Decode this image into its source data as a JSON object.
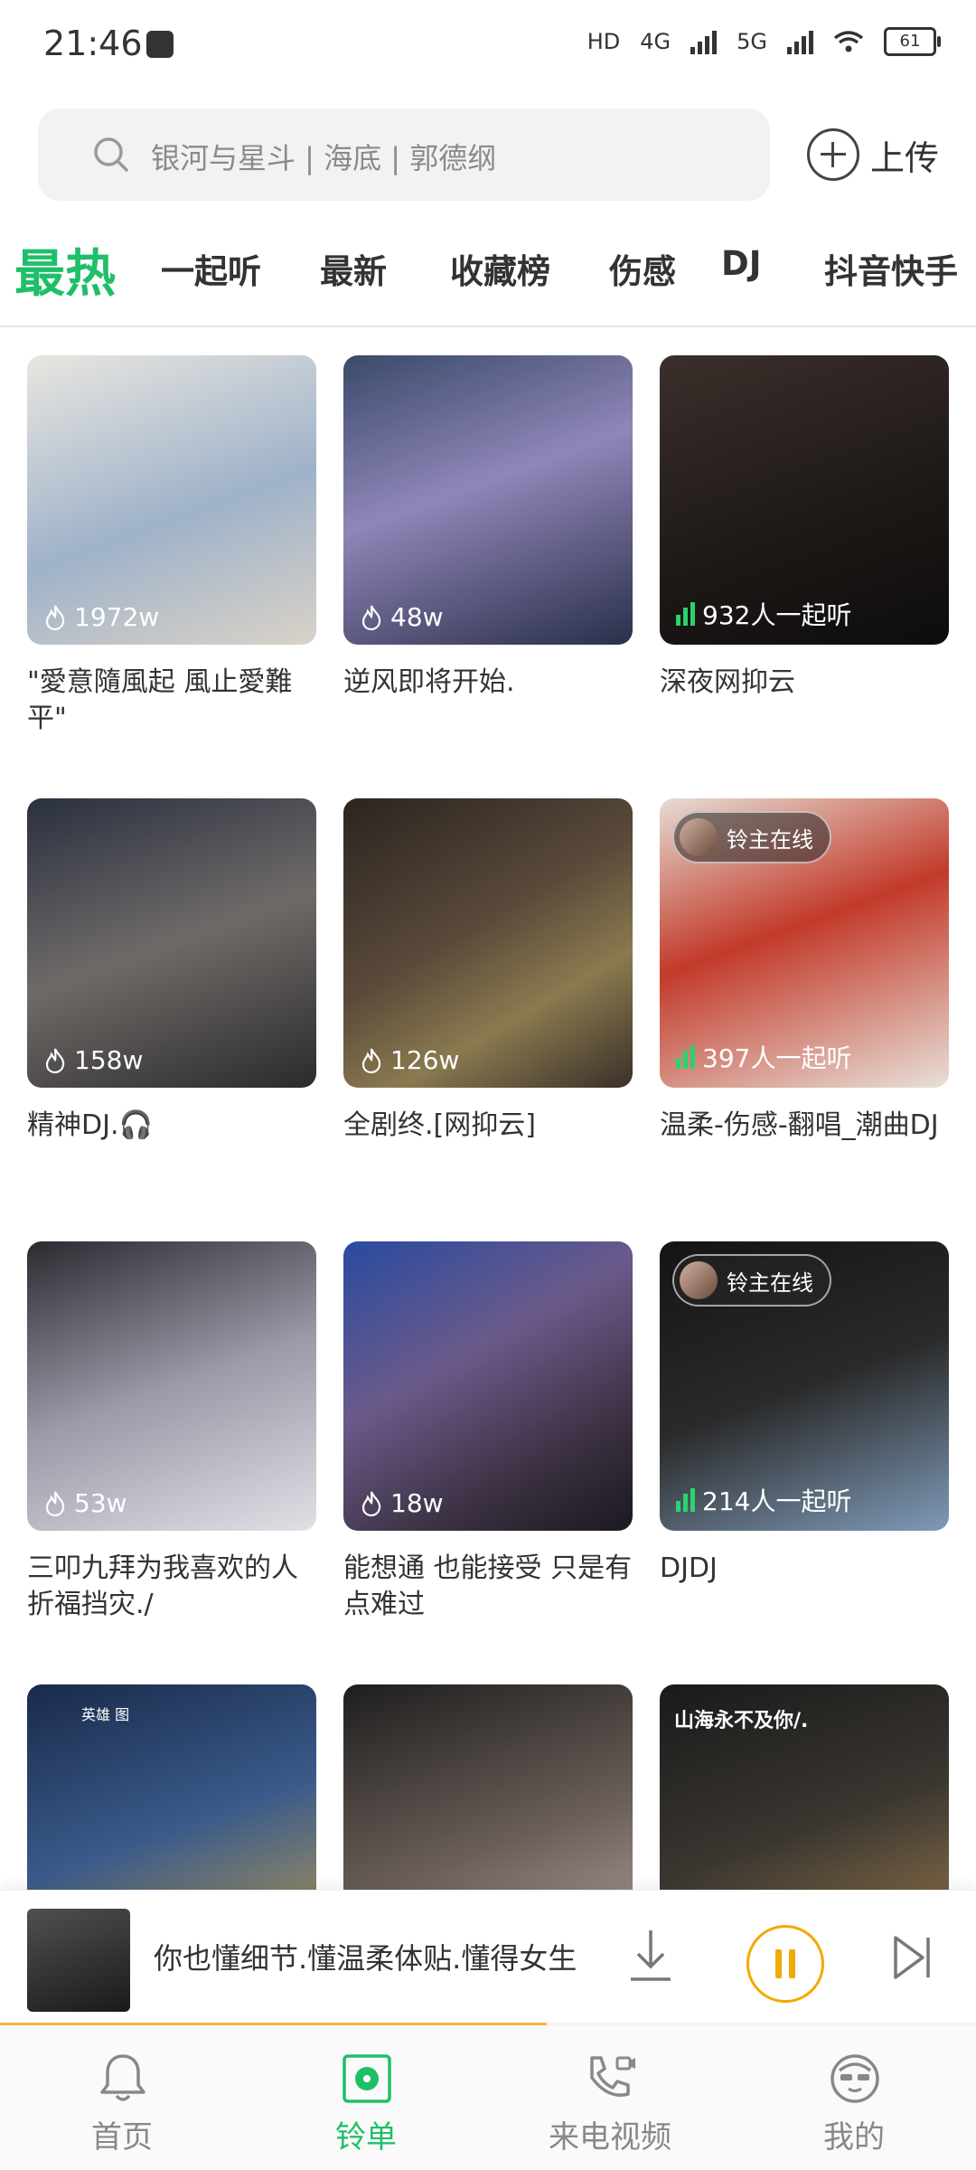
{
  "status_bar": {
    "time": "21:46",
    "battery": "61",
    "network_1": "4G",
    "network_2": "5G",
    "hd_label": "HD"
  },
  "search": {
    "placeholder": "银河与星斗 | 海底 | 郭德纲"
  },
  "upload": {
    "label": "上传"
  },
  "tabs": [
    {
      "label": "最热"
    },
    {
      "label": "一起听"
    },
    {
      "label": "最新"
    },
    {
      "label": "收藏榜"
    },
    {
      "label": "伤感"
    },
    {
      "label": "DJ"
    },
    {
      "label": "抖音快手"
    }
  ],
  "cards": [
    {
      "title": "\"愛意隨風起 風止愛難平\"",
      "count": "1972w",
      "count_type": "hot"
    },
    {
      "title": "逆风即将开始.",
      "count": "48w",
      "count_type": "hot"
    },
    {
      "title": "深夜网抑云",
      "count": "932人一起听",
      "count_type": "listening"
    },
    {
      "title": "精神DJ.🎧",
      "count": "158w",
      "count_type": "hot"
    },
    {
      "title": "全剧终.[网抑云]",
      "count": "126w",
      "count_type": "hot"
    },
    {
      "title": "温柔-伤感-翻唱_潮曲DJ",
      "count": "397人一起听",
      "count_type": "listening",
      "badge": "铃主在线"
    },
    {
      "title": "三叩九拜为我喜欢的人折福挡灾./",
      "count": "53w",
      "count_type": "hot"
    },
    {
      "title": "能想通 也能接受 只是有点难过",
      "count": "18w",
      "count_type": "hot"
    },
    {
      "title": "DJDJ",
      "count": "214人一起听",
      "count_type": "listening",
      "badge": "铃主在线"
    },
    {
      "title": "",
      "count": "",
      "count_type": "none",
      "overlay_text": "英雄 图"
    },
    {
      "title": "",
      "count": "",
      "count_type": "none"
    },
    {
      "title": "",
      "count": "",
      "count_type": "none",
      "overlay_text": "山海永不及你/."
    }
  ],
  "player": {
    "now_playing": "你也懂细节.懂温柔体贴.懂得女生",
    "progress": 0.56
  },
  "bottom_nav": [
    {
      "label": "首页",
      "icon": "bell-icon"
    },
    {
      "label": "铃单",
      "icon": "playlist-disc-icon",
      "active": true
    },
    {
      "label": "来电视频",
      "icon": "phone-video-icon"
    },
    {
      "label": "我的",
      "icon": "profile-avatar-icon"
    }
  ],
  "colors": {
    "accent": "#1fbf6a",
    "player_accent": "#f2a900",
    "listening_green": "#2ad36b"
  }
}
